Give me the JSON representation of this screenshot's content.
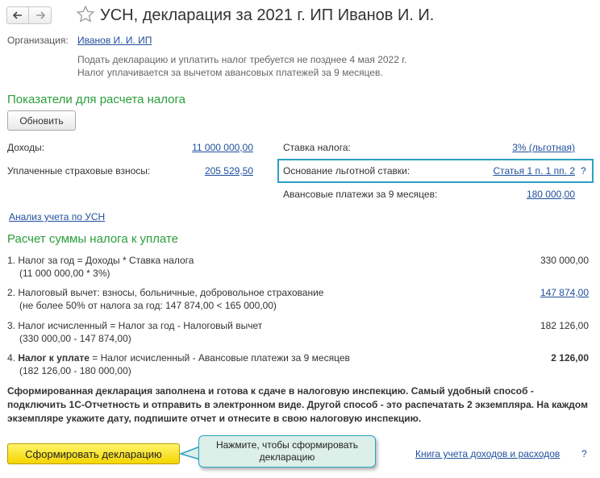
{
  "header": {
    "title": "УСН, декларация за 2021 г. ИП Иванов И. И."
  },
  "org": {
    "label": "Организация:",
    "value": "Иванов И. И. ИП"
  },
  "notes": {
    "line1": "Подать декларацию и уплатить налог требуется не позднее 4 мая 2022 г.",
    "line2": "Налог уплачивается за вычетом авансовых платежей за 9 месяцев."
  },
  "indicators": {
    "heading": "Показатели для расчета налога",
    "refresh_label": "Обновить",
    "income_label": "Доходы:",
    "income_value": "11 000 000,00",
    "insurance_label": "Уплаченные страховые взносы:",
    "insurance_value": "205 529,50",
    "rate_label": "Ставка налога:",
    "rate_value": "3% (льготная)",
    "basis_label": "Основание льготной ставки:",
    "basis_value": "Статья 1 п. 1 пп. 2",
    "basis_help": "?",
    "advance_label": "Авансовые платежи за 9 месяцев:",
    "advance_value": "180 000,00",
    "analysis_link": "Анализ учета по УСН"
  },
  "calc": {
    "heading": "Расчет суммы налога к уплате",
    "rows": [
      {
        "line1": "1. Налог за год = Доходы * Ставка налога",
        "line2": "(11 000 000,00 * 3%)",
        "value": "330 000,00"
      },
      {
        "line1": "2. Налоговый вычет: взносы, больничные, добровольное страхование",
        "line2": "(не более 50% от налога за год: 147 874,00 < 165 000,00)",
        "value": "147 874,00"
      },
      {
        "line1": "3. Налог исчисленный = Налог за год - Налоговый вычет",
        "line2": "(330 000,00 - 147 874,00)",
        "value": "182 126,00"
      },
      {
        "line1_num": "4. ",
        "line1_bold": "Налог к уплате",
        "line1_rest": " = Налог исчисленный - Авансовые платежи за 9 месяцев",
        "line2": "(182 126,00 - 180 000,00)",
        "value": "2 126,00"
      }
    ]
  },
  "info_text": "Сформированная декларация заполнена и готова к сдаче в налоговую инспекцию. Самый удобный способ - подключить 1С-Отчетность и отправить в электронном виде. Другой способ - это распечатать 2 экземпляра. На каждом экземпляре укажите дату, подпишите отчет и отнесите в свою налоговую инспекцию.",
  "footer": {
    "generate_label": "Сформировать декларацию",
    "callout_text": "Нажмите, чтобы сформировать декларацию",
    "ledger_link": "Книга учета доходов и расходов",
    "ledger_help": "?"
  },
  "colors": {
    "accent_green": "#2b9e3b",
    "link_blue": "#1f4e9c",
    "highlight": "#2aa1c2",
    "button_yellow": "#f5d500"
  }
}
